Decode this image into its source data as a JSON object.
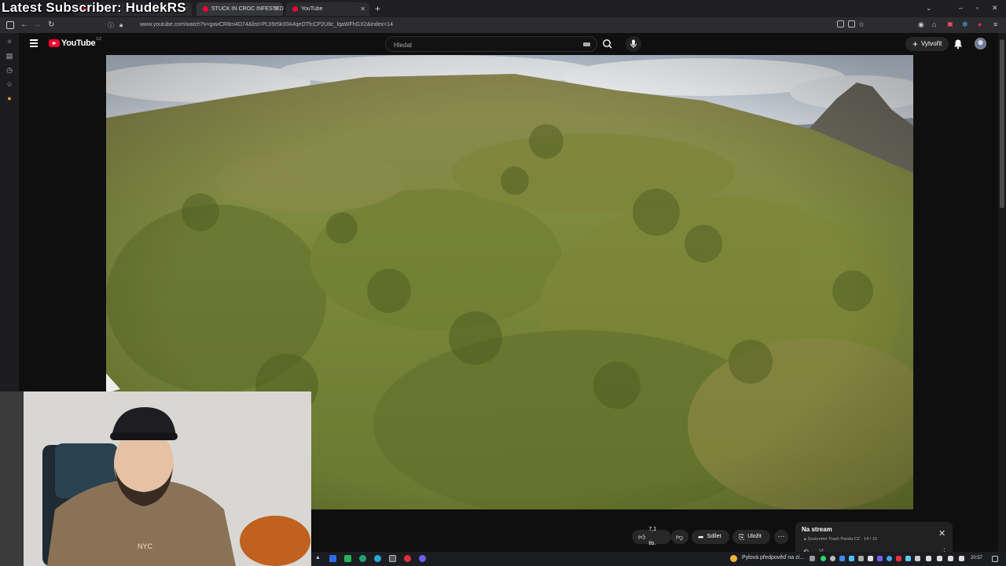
{
  "overlay": {
    "latest_subscriber": "Latest Subscriber: HudekRS"
  },
  "tabs": [
    {
      "label": "STUCK IN CROC INFESTED"
    },
    {
      "label": "YouTube"
    }
  ],
  "address_bar": {
    "url": "www.youtube.com/watch?v=gxwCR8m4O74&list=PL09r5k00A4qeOTfcCP2U6c_lqaWFhGX2&index=14"
  },
  "header": {
    "logo_text": "YouTube",
    "country_code": "CZ",
    "search_placeholder": "Hledat",
    "create_label": "Vytvořit"
  },
  "actions": {
    "like_count": "7,1 tis.",
    "share_label": "Sdílet",
    "save_label": "Uložit"
  },
  "mini_player": {
    "title": "Na stream",
    "privacy": "Soukromé",
    "channel": "Trash Panda CZ",
    "position": "14 / 19"
  },
  "taskbar": {
    "weather_text": "Pylová předpověď na zí...",
    "time": "20:57"
  },
  "webcam": {
    "hoodie_text": "NYC"
  },
  "colors": {
    "brand_red": "#ff0033",
    "page_bg": "#0f0f0f",
    "chip_bg": "#272727"
  }
}
